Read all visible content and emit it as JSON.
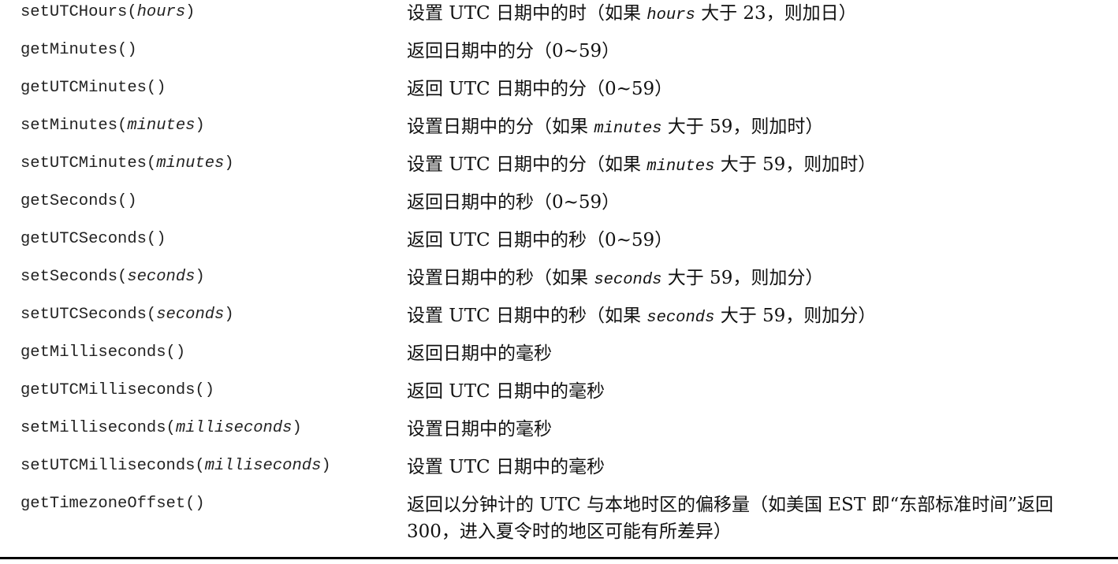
{
  "rows": [
    {
      "method": "setUTCHours(",
      "arg": "hours",
      "end": ")",
      "desc_a": "设置 UTC 日期中的时（如果 ",
      "desc_code": "hours",
      "desc_b": " 大于 23，则加日）"
    },
    {
      "method": "getMinutes()",
      "arg": "",
      "end": "",
      "desc_a": "返回日期中的分（0~59）",
      "desc_code": "",
      "desc_b": ""
    },
    {
      "method": "getUTCMinutes()",
      "arg": "",
      "end": "",
      "desc_a": "返回 UTC 日期中的分（0~59）",
      "desc_code": "",
      "desc_b": ""
    },
    {
      "method": "setMinutes(",
      "arg": "minutes",
      "end": ")",
      "desc_a": "设置日期中的分（如果 ",
      "desc_code": "minutes",
      "desc_b": " 大于 59，则加时）"
    },
    {
      "method": "setUTCMinutes(",
      "arg": "minutes",
      "end": ")",
      "desc_a": "设置 UTC 日期中的分（如果 ",
      "desc_code": "minutes",
      "desc_b": " 大于 59，则加时）"
    },
    {
      "method": "getSeconds()",
      "arg": "",
      "end": "",
      "desc_a": "返回日期中的秒（0~59）",
      "desc_code": "",
      "desc_b": ""
    },
    {
      "method": "getUTCSeconds()",
      "arg": "",
      "end": "",
      "desc_a": "返回 UTC 日期中的秒（0~59）",
      "desc_code": "",
      "desc_b": ""
    },
    {
      "method": "setSeconds(",
      "arg": "seconds",
      "end": ")",
      "desc_a": "设置日期中的秒（如果 ",
      "desc_code": "seconds",
      "desc_b": " 大于 59，则加分）"
    },
    {
      "method": "setUTCSeconds(",
      "arg": "seconds",
      "end": ")",
      "desc_a": "设置 UTC 日期中的秒（如果 ",
      "desc_code": "seconds",
      "desc_b": " 大于 59，则加分）"
    },
    {
      "method": "getMilliseconds()",
      "arg": "",
      "end": "",
      "desc_a": "返回日期中的毫秒",
      "desc_code": "",
      "desc_b": ""
    },
    {
      "method": "getUTCMilliseconds()",
      "arg": "",
      "end": "",
      "desc_a": "返回 UTC 日期中的毫秒",
      "desc_code": "",
      "desc_b": ""
    },
    {
      "method": "setMilliseconds(",
      "arg": "milliseconds",
      "end": ")",
      "desc_a": "设置日期中的毫秒",
      "desc_code": "",
      "desc_b": ""
    },
    {
      "method": "setUTCMilliseconds(",
      "arg": "milliseconds",
      "end": ")",
      "desc_a": "设置 UTC 日期中的毫秒",
      "desc_code": "",
      "desc_b": ""
    },
    {
      "method": "getTimezoneOffset()",
      "arg": "",
      "end": "",
      "desc_a": "返回以分钟计的 UTC 与本地时区的偏移量（如美国 EST 即“东部标准时间”返回 300，进入夏令时的地区可能有所差异）",
      "desc_code": "",
      "desc_b": ""
    }
  ]
}
